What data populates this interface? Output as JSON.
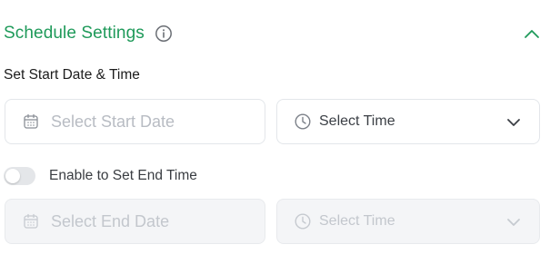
{
  "header": {
    "title": "Schedule Settings",
    "info_icon": "info-circle-icon",
    "collapse_icon": "chevron-up-icon"
  },
  "start": {
    "label": "Set Start Date & Time",
    "date_placeholder": "Select Start Date",
    "time_label": "Select Time"
  },
  "end_toggle": {
    "label": "Enable to Set End Time",
    "enabled": false
  },
  "end": {
    "date_placeholder": "Select End Date",
    "time_label": "Select Time",
    "disabled": true
  },
  "colors": {
    "accent": "#1f9a5a",
    "border": "#e3e6ea",
    "disabled_bg": "#f4f5f7",
    "placeholder": "#b8bcc3"
  }
}
